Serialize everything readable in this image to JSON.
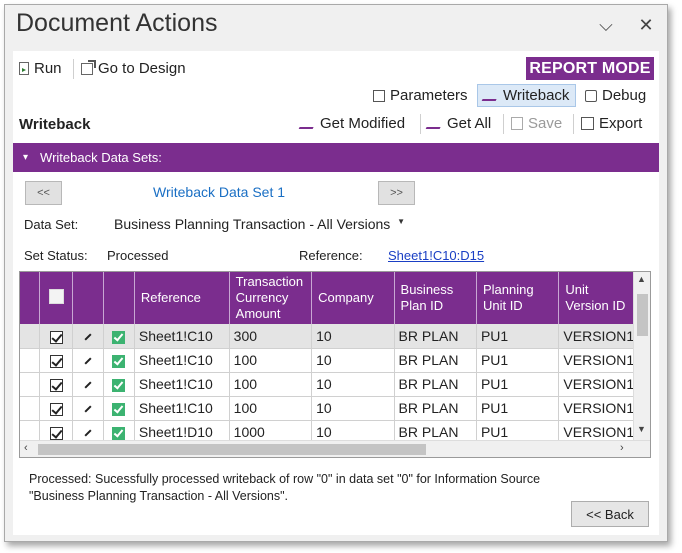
{
  "window": {
    "title": "Document Actions"
  },
  "toolbar": {
    "run": "Run",
    "go_to_design": "Go to Design",
    "report_mode": "REPORT MODE",
    "accent_color": "#7b2d8e"
  },
  "tabs": {
    "parameters": "Parameters",
    "writeback": "Writeback",
    "debug": "Debug"
  },
  "writeback": {
    "section_label": "Writeback",
    "get_modified": "Get Modified",
    "get_all": "Get All",
    "save": "Save",
    "export": "Export"
  },
  "datasets": {
    "bar_label": "Writeback Data Sets:",
    "prev": "<<",
    "next": ">>",
    "current_title": "Writeback Data Set 1",
    "data_set_label": "Data Set:",
    "data_set_value": "Business Planning Transaction - All Versions",
    "set_status_label": "Set Status:",
    "set_status_value": "Processed",
    "reference_label": "Reference:",
    "reference_value": "Sheet1!C10:D15"
  },
  "grid": {
    "columns": [
      "Reference",
      "Transaction Currency Amount",
      "Company",
      "Business Plan ID",
      "Planning Unit ID",
      "Unit Version ID"
    ],
    "rows": [
      [
        "Sheet1!C10",
        "300",
        "10",
        "BR PLAN",
        "PU1",
        "VERSION1"
      ],
      [
        "Sheet1!C10",
        "100",
        "10",
        "BR PLAN",
        "PU1",
        "VERSION1"
      ],
      [
        "Sheet1!C10",
        "100",
        "10",
        "BR PLAN",
        "PU1",
        "VERSION1"
      ],
      [
        "Sheet1!C10",
        "100",
        "10",
        "BR PLAN",
        "PU1",
        "VERSION1"
      ],
      [
        "Sheet1!D10",
        "1000",
        "10",
        "BR PLAN",
        "PU1",
        "VERSION1"
      ]
    ]
  },
  "status": {
    "message": "Processed: Sucessfully processed writeback of row \"0\" in data set \"0\" for Information Source \"Business Planning Transaction - All Versions\"."
  },
  "footer": {
    "back": "<< Back"
  }
}
